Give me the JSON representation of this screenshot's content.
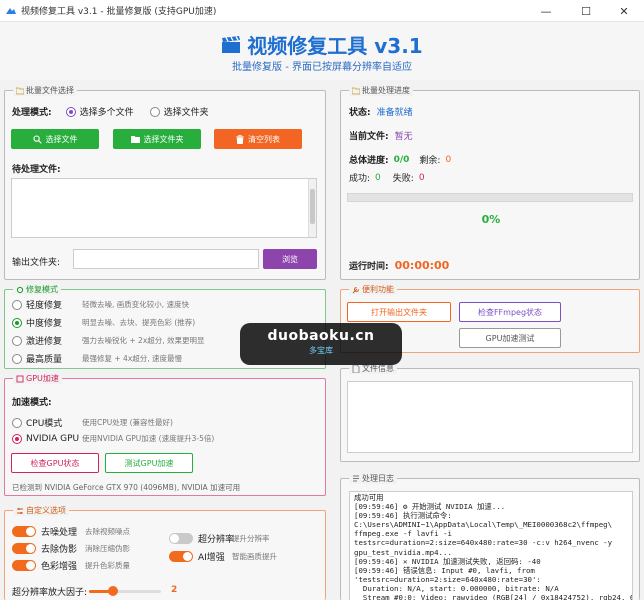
{
  "window": {
    "title": "视频修复工具 v3.1 - 批量修复版 (支持GPU加速)",
    "minimize": "—",
    "maximize": "☐",
    "close": "✕"
  },
  "header": {
    "title": "视频修复工具 v3.1",
    "subtitle": "批量修复版 - 界面已按屏幕分辨率自适应"
  },
  "batch_select": {
    "title": "批量文件选择",
    "mode_label": "处理模式:",
    "mode_options": [
      "选择多个文件",
      "选择文件夹"
    ],
    "selected_mode": 0,
    "select_files": "选择文件",
    "select_folder": "选择文件夹",
    "clear_list": "清空列表",
    "pending_label": "待处理文件:",
    "output_label": "输出文件夹:",
    "output_value": "",
    "browse": "浏览"
  },
  "progress": {
    "title": "批量处理进度",
    "status_label": "状态:",
    "status_value": "准备就绪",
    "current_label": "当前文件:",
    "current_value": "暂无",
    "total_label": "总体进度:",
    "total_value": "0/0",
    "remaining_label": "剩余:",
    "remaining_value": "0",
    "success_label": "成功:",
    "success_value": "0",
    "fail_label": "失败:",
    "fail_value": "0",
    "percent": 0,
    "percent_text": "0%",
    "runtime_label": "运行时间:",
    "runtime_value": "00:00:00"
  },
  "repair_mode": {
    "title": "修复模式",
    "options": [
      {
        "name": "轻度修复",
        "desc": "轻微去噪, 画质变化较小, 速度快"
      },
      {
        "name": "中度修复",
        "desc": "明显去噪、去块、提亮色彩 (推荐)"
      },
      {
        "name": "激进修复",
        "desc": "强力去噪锐化 + 2x超分, 效果更明显"
      },
      {
        "name": "最高质量",
        "desc": "最强修复 + 4x超分, 速度最慢"
      }
    ],
    "selected": 1
  },
  "tools": {
    "title": "便利功能",
    "open_output": "打开输出文件夹",
    "check_ffmpeg": "检查FFmpeg状态",
    "gpu_test": "GPU加速测试"
  },
  "gpu": {
    "title": "GPU加速",
    "mode_label": "加速模式:",
    "options": [
      {
        "name": "CPU模式",
        "desc": "使用CPU处理 (兼容性最好)"
      },
      {
        "name": "NVIDIA GPU",
        "desc": "使用NVIDIA GPU加速 (速度提升3-5倍)"
      }
    ],
    "selected": 1,
    "check_status": "检查GPU状态",
    "test_gpu": "测试GPU加速",
    "detected": "已检测到 NVIDIA GeForce GTX 970 (4096MB), NVIDIA 加速可用"
  },
  "file_info": {
    "title": "文件信息"
  },
  "custom": {
    "title": "自定义选项",
    "toggles": [
      {
        "name": "去噪处理",
        "desc": "去除视频噪点",
        "on": true
      },
      {
        "name": "去除伪影",
        "desc": "消除压缩伪影",
        "on": true
      },
      {
        "name": "色彩增强",
        "desc": "提升色彩质量",
        "on": true
      }
    ],
    "toggles_right": [
      {
        "name": "超分辨率",
        "desc": "提升分辨率",
        "on": false
      },
      {
        "name": "AI增强",
        "desc": "智能画质提升",
        "on": true
      }
    ],
    "scale_label": "超分辨率放大因子:",
    "scale_value": "2",
    "scale_min": 1,
    "scale_max": 4
  },
  "log": {
    "title": "处理日志",
    "lines": [
      "成功可用",
      "[09:59:46] ⚙ 开始测试 NVIDIA 加速...",
      "[09:59:46] 执行测试命令:",
      "C:\\Users\\ADMINI~1\\AppData\\Local\\Temp\\_MEI0000368c2\\ffmpeg\\",
      "ffmpeg.exe -f lavfi -i",
      "testsrc=duration=2:size=640x480:rate=30 -c:v h264_nvenc -y",
      "gpu_test_nvidia.mp4...",
      "[09:59:46] ✕ NVIDIA 加速测试失败, 返回码: -40",
      "[09:59:46] 错误信息: Input #0, lavfi, from",
      "'testsrc=duration=2:size=640x480:rate=30':",
      "  Duration: N/A, start: 0.000000, bitrate: N/A",
      "  Stream #0:0: Video: rawvideo (RGB[24] / 0x18424752), rgb24, 640x480 [SAR"
    ]
  },
  "watermark": {
    "domain": "duobaoku.cn",
    "name": "多宝库"
  },
  "colors": {
    "accent_blue": "#1e6fd0",
    "green": "#27ae3c",
    "orange": "#f26522",
    "purple": "#8e44ad",
    "magenta": "#d0245a"
  }
}
